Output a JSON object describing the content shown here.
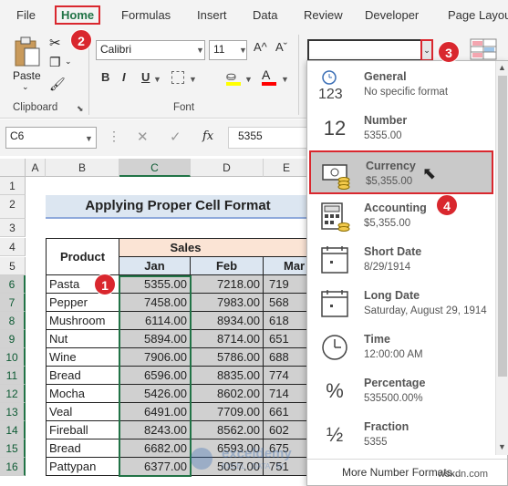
{
  "menu": {
    "tabs": [
      "File",
      "Home",
      "Formulas",
      "Insert",
      "Data",
      "Review",
      "Developer",
      "Page Layou"
    ]
  },
  "ribbon": {
    "clipboard": {
      "paste_label": "Paste",
      "group_label": "Clipboard"
    },
    "font": {
      "font_name": "Calibri",
      "font_size": "11",
      "grow": "A^",
      "shrink": "Aˇ",
      "bold": "B",
      "italic": "I",
      "underline": "U",
      "group_label": "Font"
    },
    "number_format_value": ""
  },
  "formula_bar": {
    "name_box": "C6",
    "fx": "fx",
    "value": "5355"
  },
  "badges": [
    "1",
    "2",
    "3",
    "4"
  ],
  "sheet": {
    "columns": [
      "A",
      "B",
      "C",
      "D",
      "E"
    ],
    "rows": [
      "1",
      "2",
      "3",
      "4",
      "5",
      "6",
      "7",
      "8",
      "9",
      "10",
      "11",
      "12",
      "13",
      "14",
      "15",
      "16"
    ],
    "title": "Applying Proper Cell Format",
    "product_header": "Product",
    "sales_header": "Sales",
    "month_headers": [
      "Jan",
      "Feb",
      "Mar"
    ],
    "data": [
      {
        "product": "Pasta",
        "jan": "5355.00",
        "feb": "7218.00",
        "mar": "719"
      },
      {
        "product": "Pepper",
        "jan": "7458.00",
        "feb": "7983.00",
        "mar": "568"
      },
      {
        "product": "Mushroom",
        "jan": "6114.00",
        "feb": "8934.00",
        "mar": "618"
      },
      {
        "product": "Nut",
        "jan": "5894.00",
        "feb": "8714.00",
        "mar": "651"
      },
      {
        "product": "Wine",
        "jan": "7906.00",
        "feb": "5786.00",
        "mar": "688"
      },
      {
        "product": "Bread",
        "jan": "6596.00",
        "feb": "8835.00",
        "mar": "774"
      },
      {
        "product": "Mocha",
        "jan": "5426.00",
        "feb": "8602.00",
        "mar": "714"
      },
      {
        "product": "Veal",
        "jan": "6491.00",
        "feb": "7709.00",
        "mar": "661"
      },
      {
        "product": "Fireball",
        "jan": "8243.00",
        "feb": "8562.00",
        "mar": "602"
      },
      {
        "product": "Bread",
        "jan": "6682.00",
        "feb": "6593.00",
        "mar": "675"
      },
      {
        "product": "Pattypan",
        "jan": "6377.00",
        "feb": "5057.00",
        "mar": "751"
      }
    ]
  },
  "number_formats": {
    "items": [
      {
        "name": "General",
        "sample": "No specific format",
        "icon": "123"
      },
      {
        "name": "Number",
        "sample": "5355.00",
        "icon": "12"
      },
      {
        "name": "Currency",
        "sample": "$5,355.00",
        "icon": "currency-icon"
      },
      {
        "name": "Accounting",
        "sample": "$5,355.00",
        "icon": "accounting-icon"
      },
      {
        "name": "Short Date",
        "sample": "8/29/1914",
        "icon": "calendar-icon"
      },
      {
        "name": "Long Date",
        "sample": "Saturday, August 29, 1914",
        "icon": "calendar-icon"
      },
      {
        "name": "Time",
        "sample": "12:00:00 AM",
        "icon": "clock-icon"
      },
      {
        "name": "Percentage",
        "sample": "535500.00%",
        "icon": "%"
      },
      {
        "name": "Fraction",
        "sample": "5355",
        "icon": "½"
      }
    ],
    "more": "More Number Formats..."
  },
  "watermark": "wsxdn.com",
  "colors": {
    "accent_red": "#d9272e",
    "excel_green": "#217346",
    "title_fill": "#dce6f1",
    "sales_fill": "#fbe4d5"
  }
}
